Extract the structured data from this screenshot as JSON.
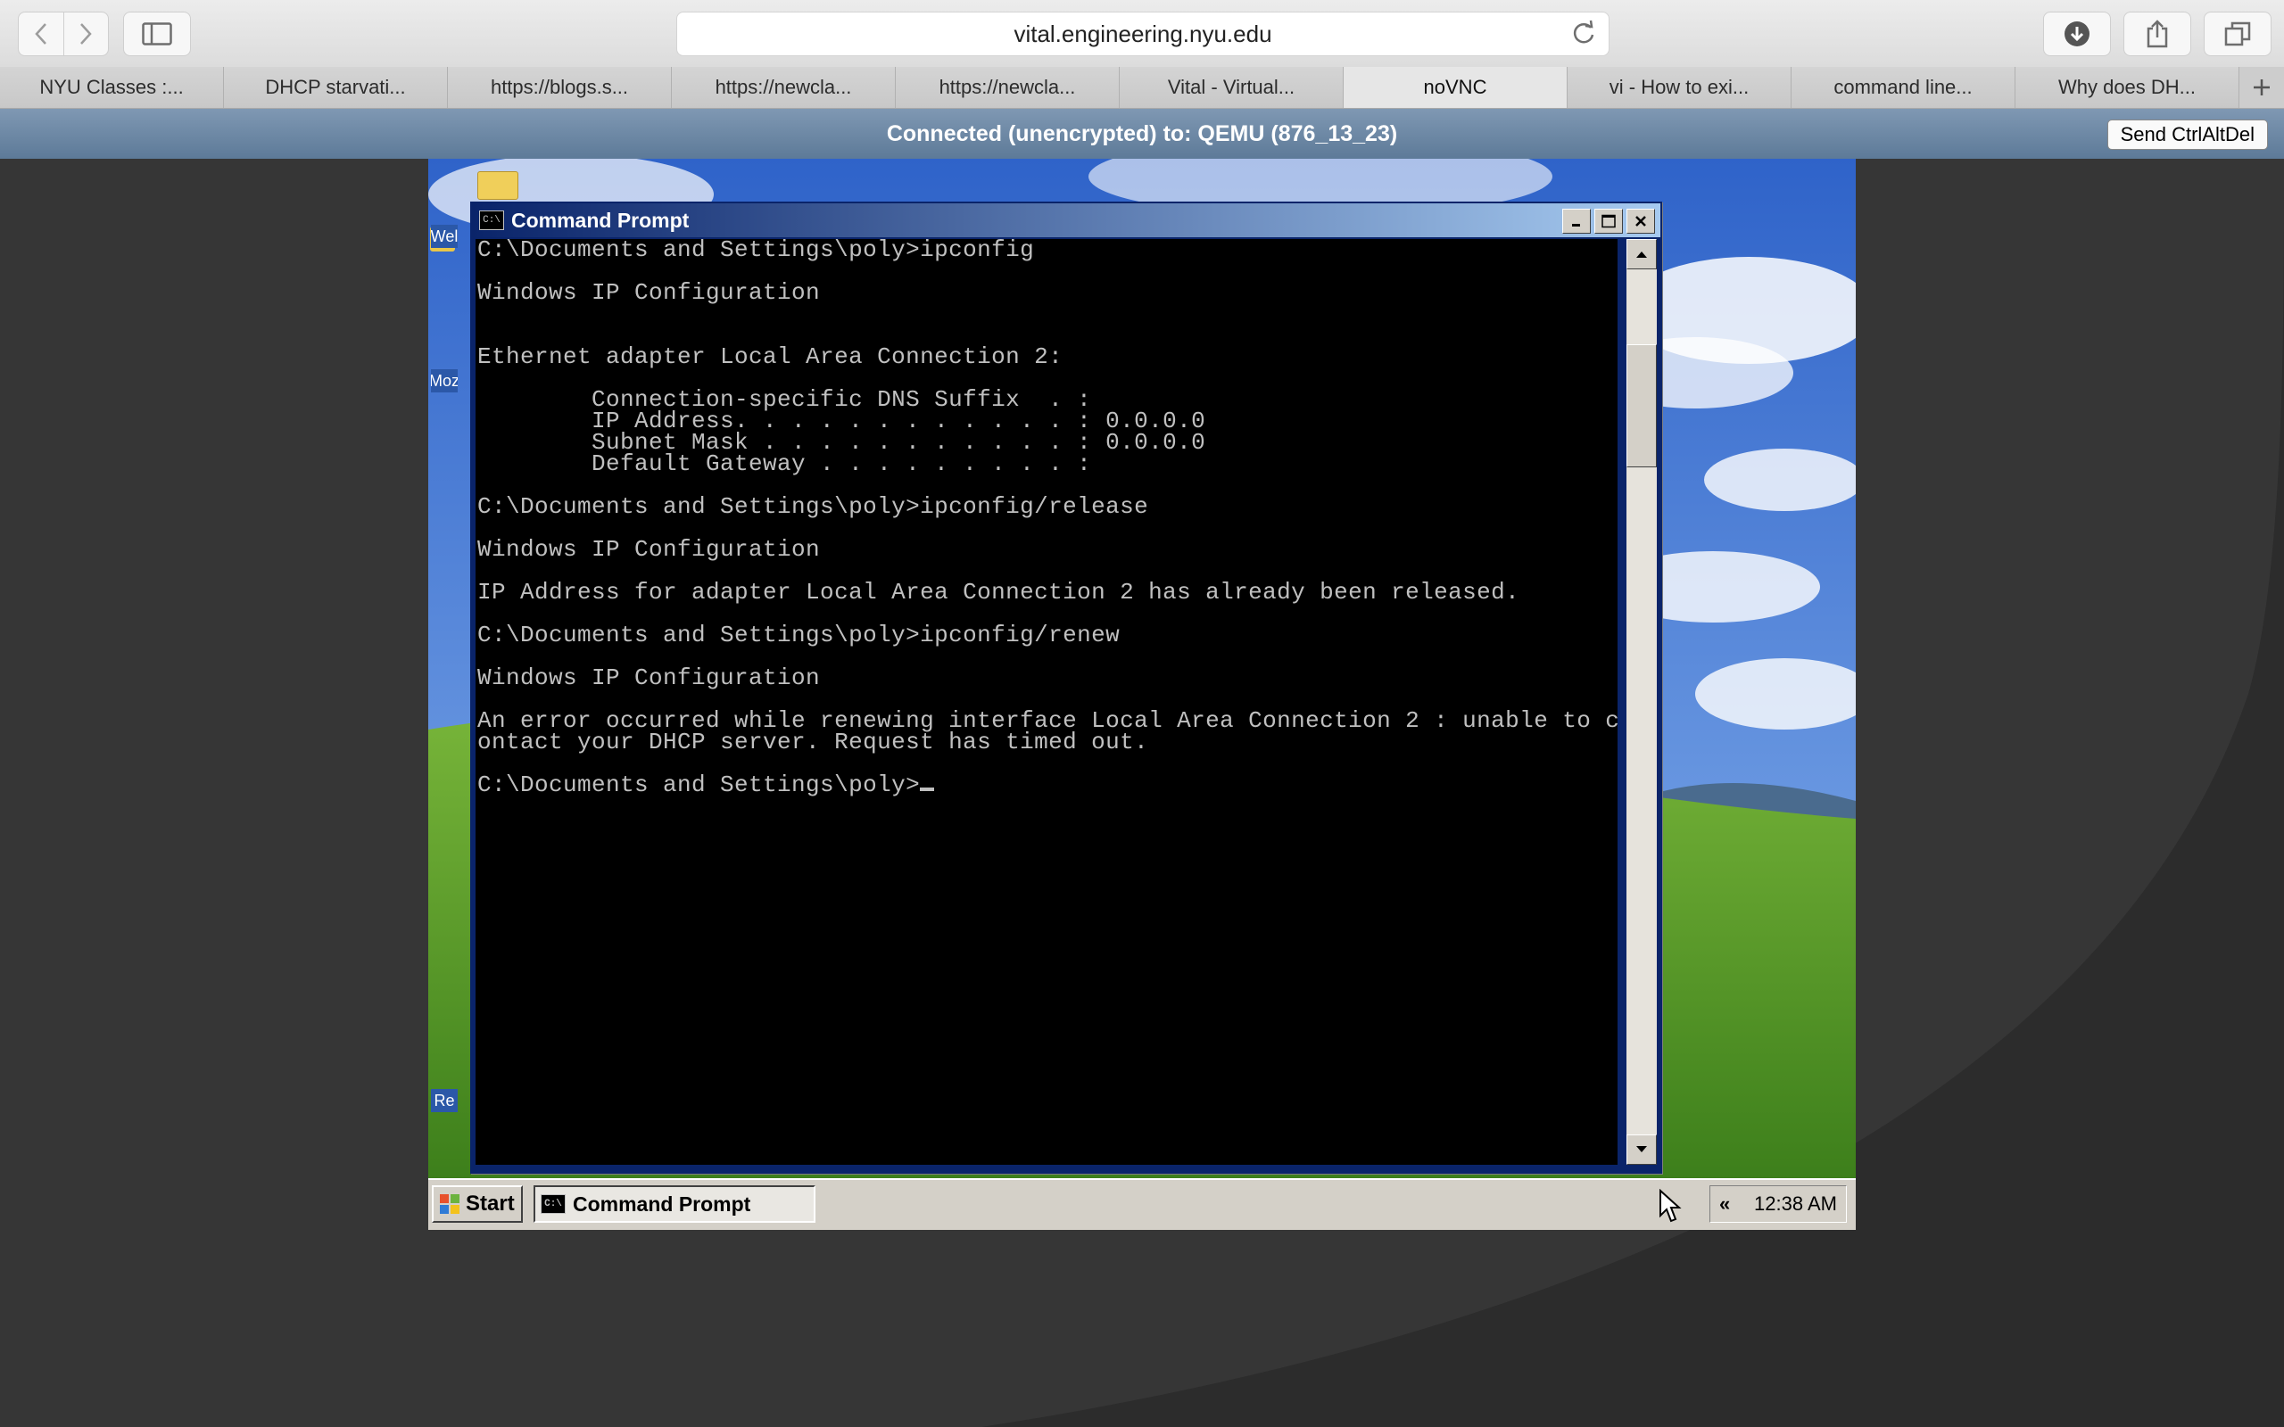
{
  "browser": {
    "address": "vital.engineering.nyu.edu",
    "tabs": [
      {
        "label": "NYU Classes :..."
      },
      {
        "label": "DHCP starvati..."
      },
      {
        "label": "https://blogs.s..."
      },
      {
        "label": "https://newcla..."
      },
      {
        "label": "https://newcla..."
      },
      {
        "label": "Vital - Virtual..."
      },
      {
        "label": "noVNC",
        "active": true
      },
      {
        "label": "vi - How to exi..."
      },
      {
        "label": "command line..."
      },
      {
        "label": "Why does DH..."
      }
    ]
  },
  "vnc": {
    "status": "Connected (unencrypted) to: QEMU (876_13_23)",
    "ctrl_alt_del_label": "Send CtrlAltDel"
  },
  "desktop": {
    "icon_labels": [
      "Wel",
      "Moz",
      "Re"
    ]
  },
  "cmd": {
    "title": "Command Prompt",
    "lines": [
      "C:\\Documents and Settings\\poly>ipconfig",
      "",
      "Windows IP Configuration",
      "",
      "",
      "Ethernet adapter Local Area Connection 2:",
      "",
      "        Connection-specific DNS Suffix  . :",
      "        IP Address. . . . . . . . . . . . : 0.0.0.0",
      "        Subnet Mask . . . . . . . . . . . : 0.0.0.0",
      "        Default Gateway . . . . . . . . . :",
      "",
      "C:\\Documents and Settings\\poly>ipconfig/release",
      "",
      "Windows IP Configuration",
      "",
      "IP Address for adapter Local Area Connection 2 has already been released.",
      "",
      "C:\\Documents and Settings\\poly>ipconfig/renew",
      "",
      "Windows IP Configuration",
      "",
      "An error occurred while renewing interface Local Area Connection 2 : unable to c",
      "ontact your DHCP server. Request has timed out.",
      "",
      "C:\\Documents and Settings\\poly>"
    ]
  },
  "taskbar": {
    "start_label": "Start",
    "task_label": "Command Prompt",
    "clock": "12:38 AM",
    "tray_toggle": "«"
  },
  "colors": {
    "xp_titlebar": "#0a246a",
    "novnc_bar": "#6e89a7",
    "console_bg": "#000000",
    "console_fg": "#c0c0c0"
  }
}
